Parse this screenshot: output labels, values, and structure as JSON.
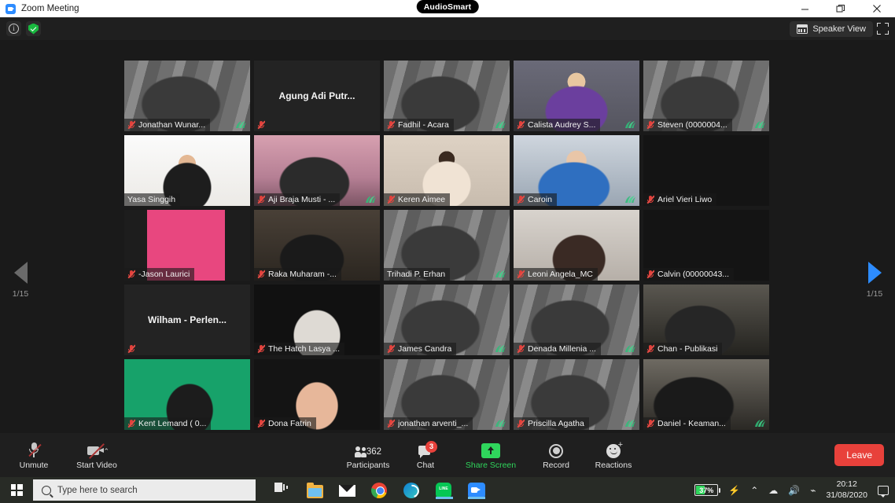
{
  "window": {
    "title": "Zoom Meeting",
    "logo_icon": "zoom-logo-icon",
    "minimize_label": "—",
    "restore_label": "❐",
    "close_label": "✕"
  },
  "header": {
    "info_icon": "info-icon",
    "security_icon": "shield-check-icon",
    "audio_badge": "AudioSmart",
    "speaker_view_label": "Speaker View",
    "speaker_view_icon": "grid-view-icon",
    "fullscreen_icon": "fullscreen-icon"
  },
  "pager": {
    "left_icon": "chevron-left-icon",
    "right_icon": "chevron-right-icon",
    "left_label": "1/15",
    "right_label": "1/15"
  },
  "gallery": {
    "tiles": [
      {
        "name": "Jonathan Wunar...",
        "muted": true,
        "video": true,
        "bg": "zoom-vb-grey",
        "speaking": true,
        "leaf": true
      },
      {
        "name": "Agung Adi Putr...",
        "muted": true,
        "video": false,
        "bg": "dark",
        "speaking": false,
        "leaf": false
      },
      {
        "name": "Fadhil - Acara",
        "muted": true,
        "video": true,
        "bg": "zoom-vb-grey",
        "speaking": false,
        "leaf": true
      },
      {
        "name": "Calista Audrey S...",
        "muted": true,
        "video": true,
        "bg": "purple-room",
        "speaking": false,
        "leaf": true
      },
      {
        "name": "Steven (0000004...",
        "muted": true,
        "video": true,
        "bg": "zoom-vb-grey",
        "speaking": false,
        "leaf": true
      },
      {
        "name": "Yasa Singgih",
        "muted": false,
        "video": true,
        "bg": "white-office",
        "speaking": true,
        "leaf": false
      },
      {
        "name": "Aji Braja Musti - ...",
        "muted": true,
        "video": true,
        "bg": "pink-room",
        "speaking": false,
        "leaf": true
      },
      {
        "name": "Keren Aimee",
        "muted": true,
        "video": true,
        "bg": "beige-room",
        "speaking": false,
        "leaf": false
      },
      {
        "name": "Caroin",
        "muted": true,
        "video": true,
        "bg": "blue-room",
        "speaking": false,
        "leaf": true
      },
      {
        "name": "Ariel Vieri Liwo",
        "muted": true,
        "video": true,
        "bg": "dark-badge",
        "speaking": false,
        "leaf": false
      },
      {
        "name": "-Jason Laurici",
        "muted": true,
        "video": true,
        "bg": "pink-flat",
        "speaking": false,
        "leaf": false
      },
      {
        "name": "Raka Muharam -...",
        "muted": true,
        "video": true,
        "bg": "dark-room",
        "speaking": false,
        "leaf": false
      },
      {
        "name": "Trihadi P. Erhan",
        "muted": false,
        "video": true,
        "bg": "zoom-vb-grey",
        "speaking": false,
        "leaf": true
      },
      {
        "name": "Leoni Angela_MC",
        "muted": true,
        "video": true,
        "bg": "marble-room",
        "speaking": false,
        "leaf": false
      },
      {
        "name": "Calvin (00000043...",
        "muted": true,
        "video": true,
        "bg": "dark-badge2",
        "speaking": false,
        "leaf": false
      },
      {
        "name": "Wilham  -  Perlen...",
        "muted": true,
        "video": false,
        "bg": "dark",
        "speaking": false,
        "leaf": false
      },
      {
        "name": "The Hatch Lasya ...",
        "muted": true,
        "video": true,
        "bg": "dark-portrait",
        "speaking": false,
        "leaf": false
      },
      {
        "name": "James Candra",
        "muted": true,
        "video": true,
        "bg": "zoom-vb-grey",
        "speaking": false,
        "leaf": true
      },
      {
        "name": "Denada Millenia ...",
        "muted": true,
        "video": true,
        "bg": "zoom-vb-grey",
        "speaking": false,
        "leaf": true
      },
      {
        "name": "Chan - Publikasi",
        "muted": true,
        "video": true,
        "bg": "dark-room2",
        "speaking": false,
        "leaf": false
      },
      {
        "name": "Kent Lemand ( 0...",
        "muted": true,
        "video": true,
        "bg": "green-room",
        "speaking": false,
        "leaf": false
      },
      {
        "name": "Dona Fatrin",
        "muted": true,
        "video": true,
        "bg": "dark-portrait2",
        "speaking": false,
        "leaf": false
      },
      {
        "name": "jonathan arventi_...",
        "muted": true,
        "video": true,
        "bg": "zoom-vb-grey",
        "speaking": false,
        "leaf": true
      },
      {
        "name": "Priscilla Agatha",
        "muted": true,
        "video": true,
        "bg": "zoom-vb-grey",
        "speaking": false,
        "leaf": true
      },
      {
        "name": "Daniel - Keaman...",
        "muted": true,
        "video": true,
        "bg": "dark-room3",
        "speaking": false,
        "leaf": true
      }
    ]
  },
  "toolbar": {
    "unmute_label": "Unmute",
    "unmute_icon": "mic-off-icon",
    "start_video_label": "Start Video",
    "start_video_icon": "camera-off-icon",
    "audio_caret": "⌃",
    "video_caret": "⌃",
    "participants_label": "Participants",
    "participants_count": "362",
    "participants_icon": "people-icon",
    "chat_label": "Chat",
    "chat_badge": "3",
    "chat_icon": "chat-bubble-icon",
    "share_label": "Share Screen",
    "share_icon": "share-screen-icon",
    "record_label": "Record",
    "record_icon": "record-circle-icon",
    "reactions_label": "Reactions",
    "reactions_icon": "smiley-plus-icon",
    "leave_label": "Leave"
  },
  "taskbar": {
    "start_icon": "windows-start-icon",
    "search_placeholder": "Type here to search",
    "search_icon": "search-icon",
    "apps": [
      {
        "icon": "task-view-icon"
      },
      {
        "icon": "file-explorer-icon"
      },
      {
        "icon": "mail-icon"
      },
      {
        "icon": "chrome-icon"
      },
      {
        "icon": "edge-icon"
      },
      {
        "icon": "line-icon"
      },
      {
        "icon": "zoom-icon"
      }
    ],
    "battery_percent": "37%",
    "battery_icon": "battery-icon",
    "plug_icon": "power-plug-icon",
    "chevron_icon": "chevron-up-icon",
    "cloud_icon": "onedrive-cloud-icon",
    "volume_icon": "volume-icon",
    "network_icon": "network-icon",
    "time": "20:12",
    "date": "31/08/2020",
    "notification_icon": "notification-icon"
  }
}
